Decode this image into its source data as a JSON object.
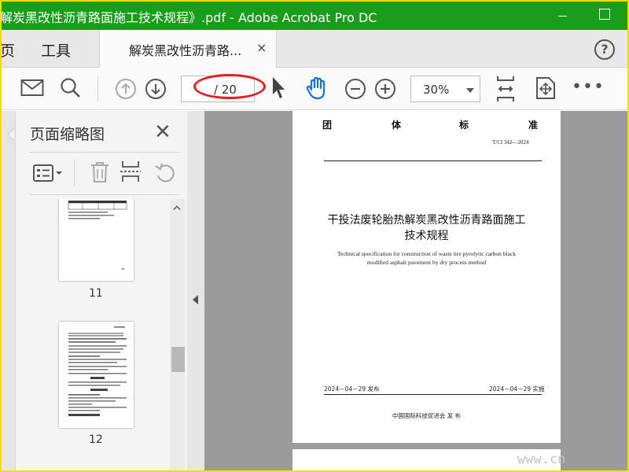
{
  "window": {
    "title": "解炭黑改性沥青路面施工技术规程》.pdf - Adobe Acrobat Pro DC"
  },
  "tabs": {
    "home_partial": "页",
    "tools": "工具",
    "doc_tab_label": "解炭黑改性沥青路...",
    "doc_tab_close": "×",
    "help": "?"
  },
  "toolbar": {
    "page_count": "/ 20",
    "zoom": "30%",
    "more": "•••"
  },
  "thumbnails_panel": {
    "title": "页面缩略图",
    "close": "✕",
    "pages": [
      {
        "label": "11"
      },
      {
        "label": "12"
      }
    ]
  },
  "document": {
    "header_chars": [
      "团",
      "体",
      "标",
      "准"
    ],
    "standard_no": "T/CI  342—2024",
    "title_line1": "干投法废轮胎热解炭黑改性沥青路面施工",
    "title_line2": "技术规程",
    "english_line1": "Technical specification for construction of  waste tire pyrolytic carbon black",
    "english_line2": "modified asphalt pavement by dry process method",
    "publish_date": "2024－04－29 发布",
    "implement_date": "2024－04－29 实施",
    "issuer": "中国国际科技促进会      发 布"
  },
  "watermark": "www.cn",
  "colors": {
    "titlebar": "#1a9d1a",
    "frame_border": "#f0e000",
    "annotation_oval": "#e02020",
    "hand_tool_active": "#1473e6"
  }
}
